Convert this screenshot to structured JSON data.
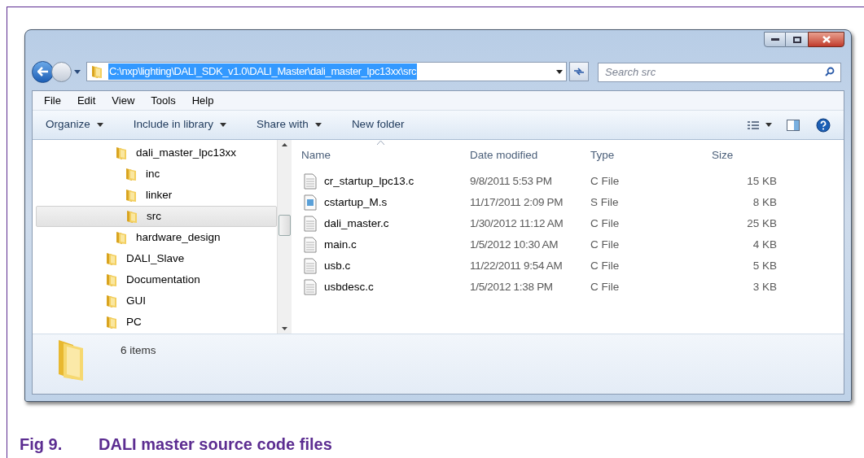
{
  "address_bar": {
    "path": "C:\\nxp\\lighting\\DALI_SDK_v1.0\\DALI_Master\\dali_master_lpc13xx\\src",
    "selected": true
  },
  "search": {
    "placeholder": "Search src"
  },
  "menu": [
    "File",
    "Edit",
    "View",
    "Tools",
    "Help"
  ],
  "toolbar": [
    {
      "label": "Organize",
      "dropdown": true
    },
    {
      "label": "Include in library",
      "dropdown": true
    },
    {
      "label": "Share with",
      "dropdown": true
    },
    {
      "label": "New folder",
      "dropdown": false
    }
  ],
  "nav_tree": [
    {
      "children": [
        {
          "label": "dali_master_lpc13xx",
          "selected": false,
          "children": [
            {
              "label": "inc",
              "selected": false
            },
            {
              "label": "linker",
              "selected": false
            },
            {
              "label": "src",
              "selected": true
            }
          ]
        },
        {
          "label": "hardware_design",
          "selected": false
        }
      ]
    },
    {
      "label": "DALI_Slave",
      "selected": false
    },
    {
      "label": "Documentation",
      "selected": false
    },
    {
      "label": "GUI",
      "selected": false
    },
    {
      "label": "PC",
      "selected": false
    }
  ],
  "columns": [
    "Name",
    "Date modified",
    "Type",
    "Size"
  ],
  "files": [
    {
      "name": "cr_startup_lpc13.c",
      "date": "9/8/2011 5:53 PM",
      "type": "C File",
      "size": "15 KB",
      "kind": "text"
    },
    {
      "name": "cstartup_M.s",
      "date": "11/17/2011 2:09 PM",
      "type": "S File",
      "size": "8 KB",
      "kind": "script"
    },
    {
      "name": "dali_master.c",
      "date": "1/30/2012 11:12 AM",
      "type": "C File",
      "size": "25 KB",
      "kind": "text"
    },
    {
      "name": "main.c",
      "date": "1/5/2012 10:30 AM",
      "type": "C File",
      "size": "4 KB",
      "kind": "text"
    },
    {
      "name": "usb.c",
      "date": "11/22/2011 9:54 AM",
      "type": "C File",
      "size": "5 KB",
      "kind": "text"
    },
    {
      "name": "usbdesc.c",
      "date": "1/5/2012 1:38 PM",
      "type": "C File",
      "size": "3 KB",
      "kind": "text"
    }
  ],
  "details": {
    "count": "6 items"
  },
  "caption": {
    "number": "Fig 9.",
    "title": "DALI master source code files"
  }
}
